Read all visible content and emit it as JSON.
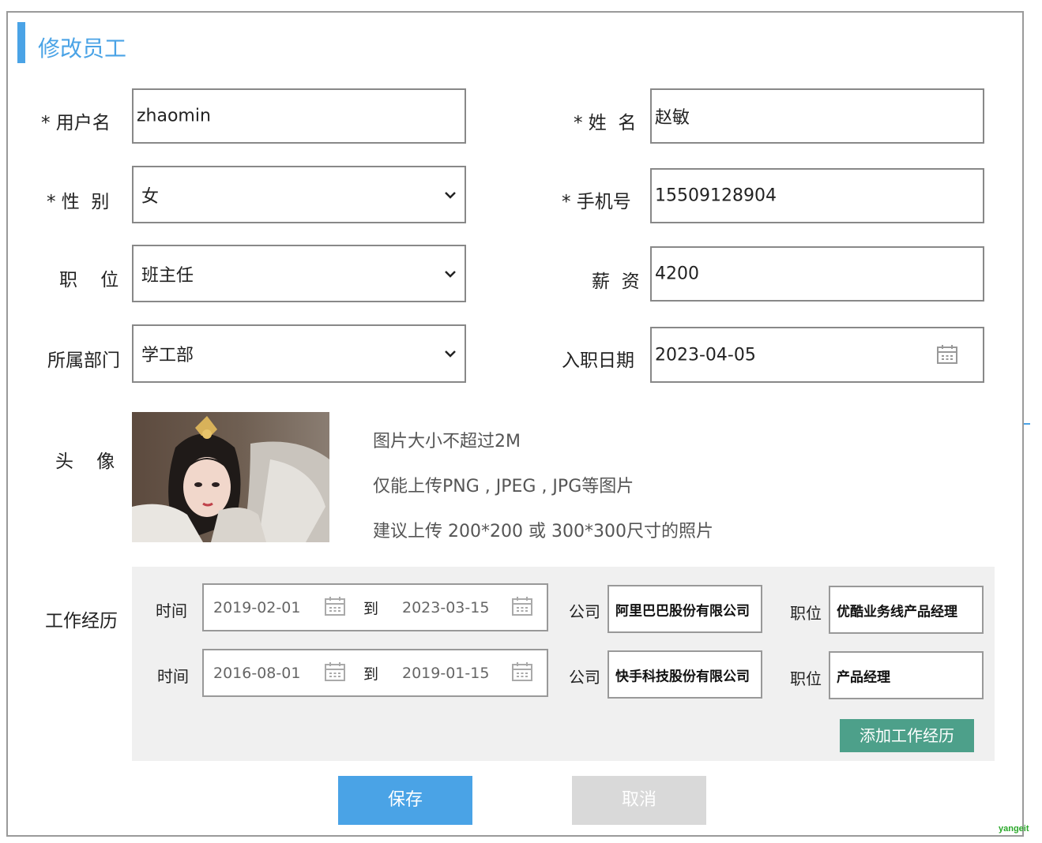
{
  "form": {
    "title": "修改员工",
    "username": {
      "label": "* 用户名",
      "value": "zhaomin"
    },
    "name": {
      "label": "* 姓  名",
      "value": "赵敏"
    },
    "gender": {
      "label": "* 性  别",
      "value": "女"
    },
    "phone": {
      "label": "* 手机号",
      "value": "15509128904"
    },
    "position": {
      "label": "职    位",
      "value": "班主任"
    },
    "salary": {
      "label": "薪  资",
      "value": "4200"
    },
    "department": {
      "label": "所属部门",
      "value": "学工部"
    },
    "entry_date": {
      "label": "入职日期",
      "value": "2023-04-05"
    },
    "avatar": {
      "label": "头    像",
      "hints": [
        "图片大小不超过2M",
        "仅能上传PNG , JPEG , JPG等图片",
        "建议上传 200*200 或 300*300尺寸的照片"
      ]
    },
    "work_experience": {
      "label": "工作经历",
      "time_label": "时间",
      "to_label": "到",
      "company_label": "公司",
      "job_label": "职位",
      "rows": [
        {
          "start": "2019-02-01",
          "end": "2023-03-15",
          "company": "阿里巴巴股份有限公司",
          "job": "优酷业务线产品经理"
        },
        {
          "start": "2016-08-01",
          "end": "2019-01-15",
          "company": "快手科技股份有限公司",
          "job": "产品经理"
        }
      ],
      "add_button": "添加工作经历"
    },
    "save_button": "保存",
    "cancel_button": "取消"
  },
  "watermark": "yangeit",
  "colors": {
    "accent": "#4aa3e6",
    "add_button": "#4da08a",
    "cancel_button": "#d9d9d9",
    "panel_bg": "#f0f0f0"
  }
}
